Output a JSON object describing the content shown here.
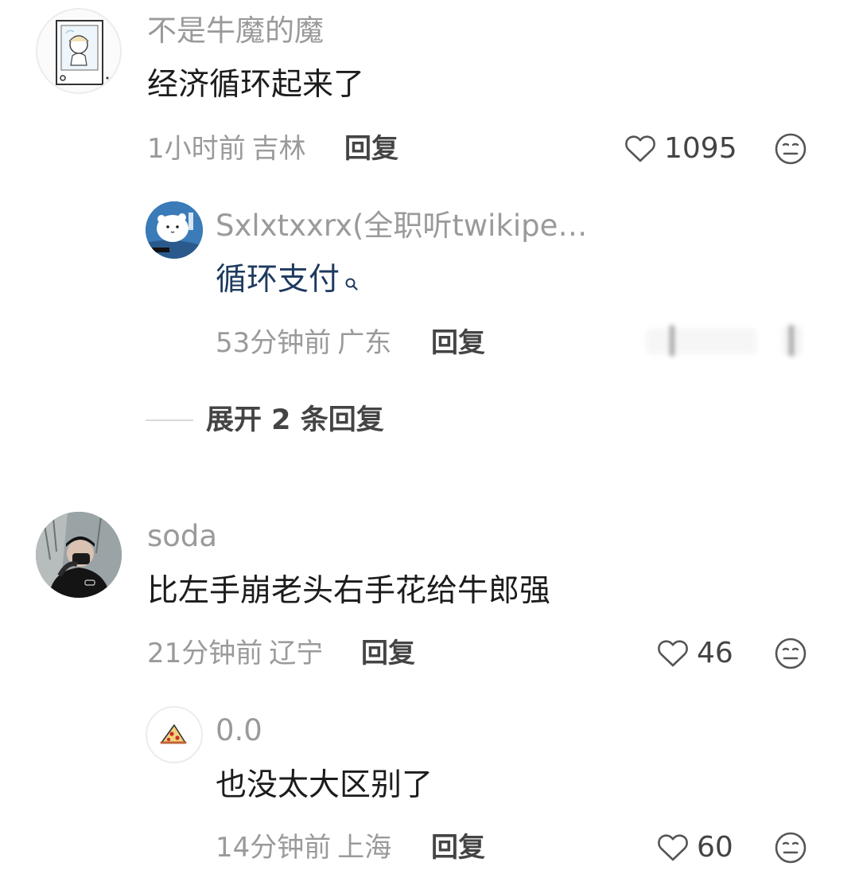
{
  "comments": [
    {
      "username": "不是牛魔的魔",
      "text": "经济循环起来了",
      "time": "1小时前",
      "location": "吉林",
      "reply_label": "回复",
      "likes": "1095",
      "avatar": "sketch-girl-avatar",
      "replies": [
        {
          "username": "Sxlxtxxrx(全职听twikipe…",
          "text": "循环支付",
          "text_is_search_link": true,
          "time": "53分钟前",
          "location": "广东",
          "reply_label": "回复",
          "avatar": "white-cat-avatar"
        }
      ],
      "expand_label": "展开 2 条回复"
    },
    {
      "username": "soda",
      "text": "比左手崩老头右手花给牛郎强",
      "time": "21分钟前",
      "location": "辽宁",
      "reply_label": "回复",
      "likes": "46",
      "avatar": "person-photo-avatar",
      "replies": [
        {
          "username": "0.0",
          "text": "也没太大区别了",
          "time": "14分钟前",
          "location": "上海",
          "reply_label": "回复",
          "likes": "60",
          "avatar": "pizza-avatar"
        }
      ]
    }
  ],
  "colors": {
    "meta_gray": "#9a9a9a",
    "text_dark": "#1c1c1c",
    "link_blue": "#1e3a5f",
    "icon_gray": "#555555"
  },
  "icons": {
    "like": "heart-outline-icon",
    "emoji": "neutral-face-icon",
    "search": "search-mini-icon"
  }
}
